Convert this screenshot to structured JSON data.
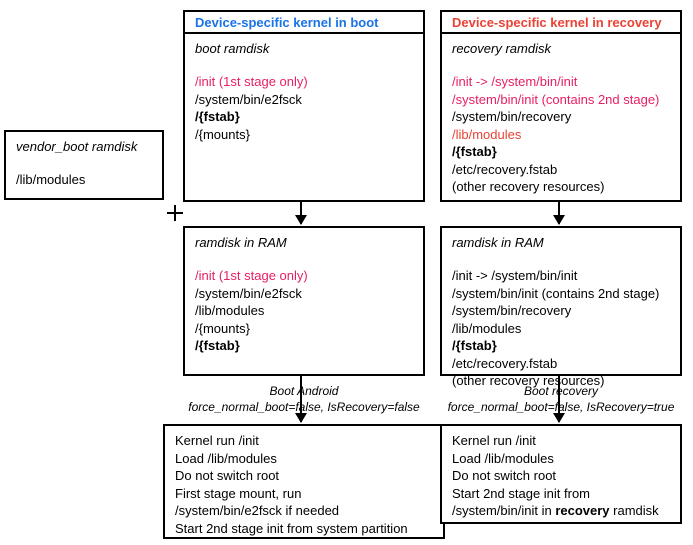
{
  "vendor": {
    "title": "vendor_boot ramdisk",
    "lines": [
      "/lib/modules"
    ]
  },
  "boot": {
    "header": "Device-specific kernel in boot",
    "title": "boot ramdisk",
    "lines": [
      {
        "text": "/init (1st stage only)",
        "cls": "magenta"
      },
      {
        "text": "/system/bin/e2fsck"
      },
      {
        "text": "/{fstab}",
        "cls": "bold"
      },
      {
        "text": "/{mounts}"
      }
    ]
  },
  "recovery": {
    "header": "Device-specific kernel in recovery",
    "title": "recovery ramdisk",
    "lines": [
      {
        "text": "/init -> /system/bin/init",
        "cls": "magenta"
      },
      {
        "text": "/system/bin/init (contains 2nd stage)",
        "cls": "magenta"
      },
      {
        "text": "/system/bin/recovery"
      },
      {
        "text": "/lib/modules",
        "cls": "red"
      },
      {
        "text": "/{fstab}",
        "cls": "bold"
      },
      {
        "text": "/etc/recovery.fstab"
      },
      {
        "text": "(other recovery resources)"
      }
    ]
  },
  "ram_boot": {
    "title": "ramdisk in RAM",
    "lines": [
      {
        "text": "/init (1st stage only)",
        "cls": "magenta"
      },
      {
        "text": "/system/bin/e2fsck"
      },
      {
        "text": "/lib/modules"
      },
      {
        "text": "/{mounts}"
      },
      {
        "text": "/{fstab}",
        "cls": "bold"
      }
    ]
  },
  "ram_rec": {
    "title": "ramdisk in RAM",
    "lines": [
      {
        "text": "/init -> /system/bin/init"
      },
      {
        "text": "/system/bin/init (contains 2nd stage)"
      },
      {
        "text": "/system/bin/recovery"
      },
      {
        "text": "/lib/modules"
      },
      {
        "text": "/{fstab}",
        "cls": "bold"
      },
      {
        "text": "/etc/recovery.fstab"
      },
      {
        "text": "(other recovery resources)"
      }
    ]
  },
  "caption_boot": {
    "l1": "Boot Android",
    "l2": "force_normal_boot=false, IsRecovery=false"
  },
  "caption_rec": {
    "l1": "Boot recovery",
    "l2": "force_normal_boot=false, IsRecovery=true"
  },
  "steps_boot": [
    "Kernel run /init",
    "Load /lib/modules",
    "Do not switch root",
    "First stage mount, run",
    "/system/bin/e2fsck if needed",
    "Start 2nd stage init from system partition"
  ],
  "steps_rec": [
    {
      "text": "Kernel run /init"
    },
    {
      "text": "Load /lib/modules"
    },
    {
      "text": "Do not switch root"
    },
    {
      "text": "Start 2nd stage init from"
    },
    {
      "html": "/system/bin/init in <b>recovery</b> ramdisk"
    }
  ]
}
